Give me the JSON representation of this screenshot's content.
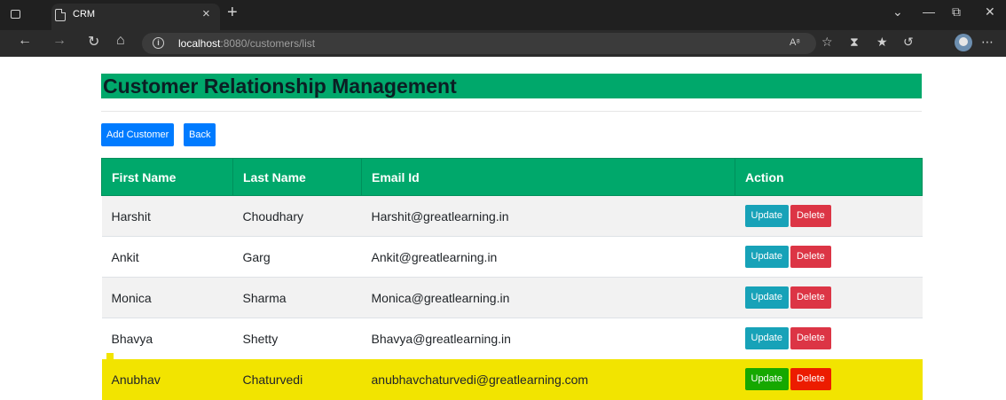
{
  "browser": {
    "tab_title": "CRM",
    "tab_close": "×",
    "new_tab": "+",
    "url_host": "localhost",
    "url_rest": ":8080/customers/list",
    "info_glyph": "i",
    "read_aloud": "A͉",
    "icons": [
      "sidebar-icon",
      "page-icon",
      "close-icon",
      "plus-icon",
      "back-icon",
      "forward-icon",
      "refresh-icon",
      "home-icon",
      "info-icon",
      "read-aloud-icon",
      "favorite-icon",
      "extensions-icon",
      "favorites-bar-icon",
      "history-icon",
      "profile-icon",
      "more-icon"
    ],
    "window_controls": {
      "minimize": "—",
      "restore": "⧉",
      "close": "✕",
      "chevron": "⌄"
    }
  },
  "page": {
    "title": "Customer Relationship Management",
    "buttons": {
      "add_customer": "Add Customer",
      "back": "Back"
    },
    "columns": [
      "First Name",
      "Last Name",
      "Email Id",
      "Action"
    ],
    "action_labels": {
      "update": "Update",
      "delete": "Delete"
    },
    "rows": [
      {
        "first": "Harshit",
        "last": "Choudhary",
        "email": "Harshit@greatlearning.in"
      },
      {
        "first": "Ankit",
        "last": "Garg",
        "email": "Ankit@greatlearning.in"
      },
      {
        "first": "Monica",
        "last": "Sharma",
        "email": "Monica@greatlearning.in"
      },
      {
        "first": "Bhavya",
        "last": "Shetty",
        "email": "Bhavya@greatlearning.in"
      },
      {
        "first": "Anubhav",
        "last": "Chaturvedi",
        "email": "anubhavchaturvedi@greatlearning.com"
      }
    ],
    "colors": {
      "header_green": "#00a86b",
      "primary": "#007bff",
      "update": "#17a2b8",
      "delete": "#dc3545",
      "highlight": "#f2e400"
    }
  }
}
